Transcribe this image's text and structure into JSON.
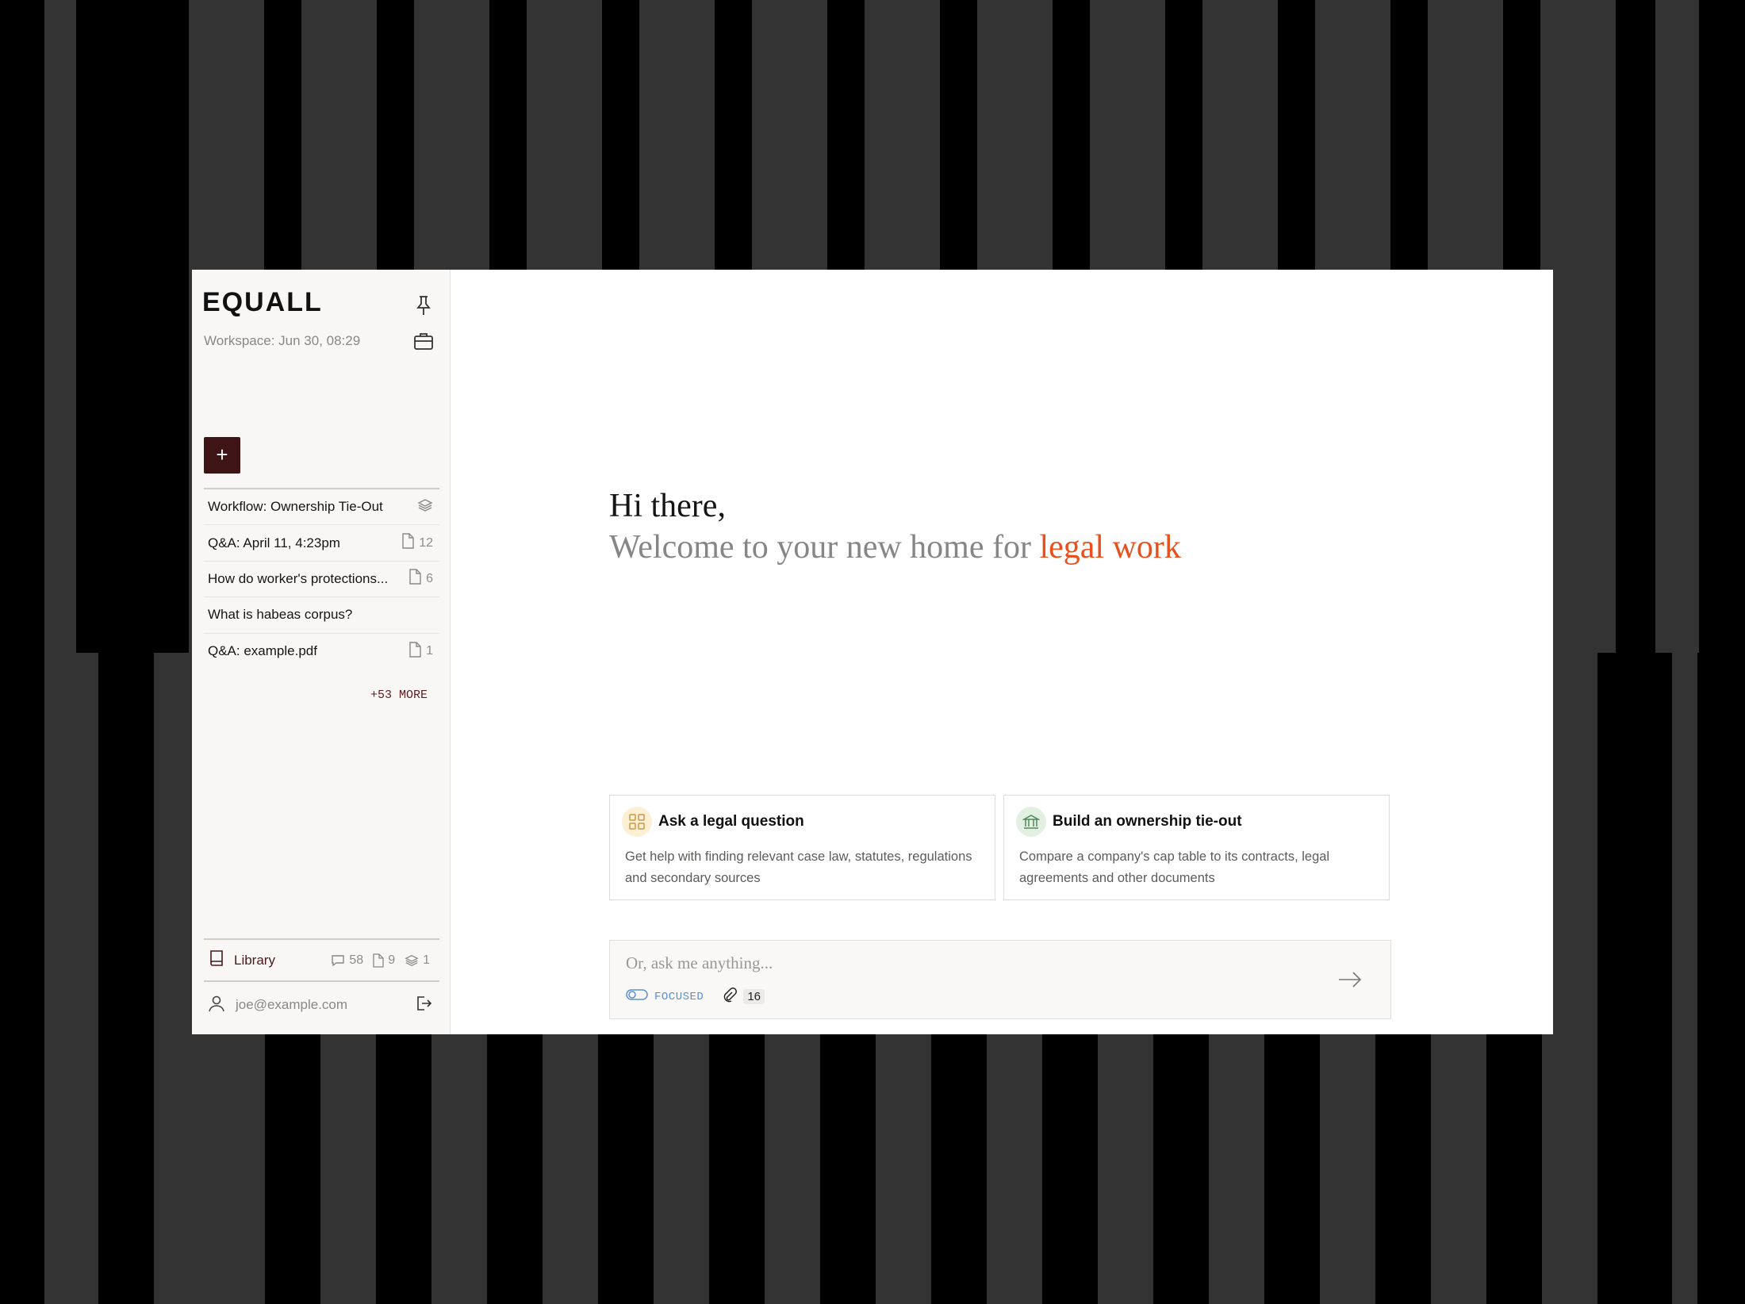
{
  "app": {
    "brand": "EQUALL",
    "workspace": "Workspace: Jun 30, 08:29"
  },
  "sidebar": {
    "new_label": "+",
    "items": [
      {
        "label": "Workflow: Ownership Tie-Out",
        "icon": "layers-icon",
        "count": ""
      },
      {
        "label": "Q&A: April 11, 4:23pm",
        "icon": "file-icon",
        "count": "12"
      },
      {
        "label": "How do worker's protections...",
        "icon": "file-icon",
        "count": "6"
      },
      {
        "label": "What is habeas corpus?",
        "icon": "",
        "count": ""
      },
      {
        "label": "Q&A: example.pdf",
        "icon": "file-icon",
        "count": "1"
      }
    ],
    "more_label": "+53 MORE",
    "library": {
      "label": "Library",
      "chats": "58",
      "files": "9",
      "workflows": "1"
    },
    "user": {
      "email": "joe@example.com"
    }
  },
  "main": {
    "greeting_line1": "Hi there,",
    "greeting_line2_prefix": "Welcome to your new home for ",
    "greeting_line2_accent": "legal work",
    "cards": [
      {
        "title": "Ask a legal question",
        "description": "Get help with finding relevant case law, statutes, regulations and secondary sources",
        "icon": "grid-icon"
      },
      {
        "title": "Build an ownership tie-out",
        "description": "Compare a company's cap table to its contracts, legal agreements and other documents",
        "icon": "bank-icon"
      }
    ],
    "ask": {
      "placeholder": "Or, ask me anything...",
      "mode_label": "FOCUSED",
      "attachments": "16"
    }
  },
  "colors": {
    "accent": "#e8501e",
    "brand_dark": "#3e1416",
    "focus_blue": "#5b8fd0"
  }
}
